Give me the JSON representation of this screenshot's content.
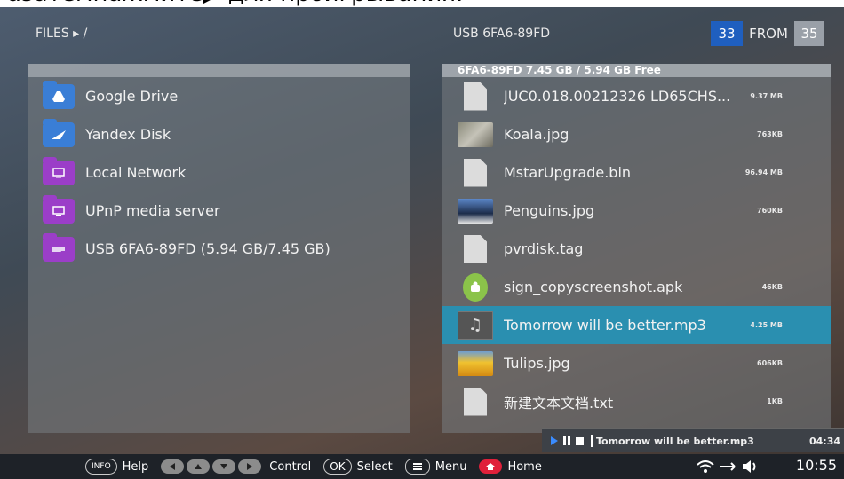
{
  "header": {
    "caption_fragment": "азатемнажмите▶ для проигрывания.",
    "path": "FILES ▸ /",
    "device": "USB 6FA6-89FD",
    "current": "33",
    "from_label": "FROM",
    "total": "35"
  },
  "left_panel": {
    "items": [
      {
        "label": "Google Drive",
        "icon": "google-drive-icon",
        "color": "#3a7ed6"
      },
      {
        "label": "Yandex Disk",
        "icon": "yandex-disk-icon",
        "color": "#3a7ed6"
      },
      {
        "label": "Local Network",
        "icon": "network-icon",
        "color": "#9b3ec8"
      },
      {
        "label": "UPnP media server",
        "icon": "upnp-icon",
        "color": "#9b3ec8"
      },
      {
        "label": "USB 6FA6-89FD (5.94 GB/7.45 GB)",
        "icon": "usb-icon",
        "color": "#9b3ec8"
      }
    ]
  },
  "right_panel": {
    "summary": "6FA6-89FD 7.45 GB / 5.94 GB Free",
    "files": [
      {
        "name": "JUC0.018.00212326  LD65CHS...",
        "size": "9.37 MB",
        "icon": "document-icon"
      },
      {
        "name": "Koala.jpg",
        "size": "763KB",
        "icon": "image-thumbnail"
      },
      {
        "name": "MstarUpgrade.bin",
        "size": "96.94 MB",
        "icon": "document-icon"
      },
      {
        "name": "Penguins.jpg",
        "size": "760KB",
        "icon": "image-thumbnail"
      },
      {
        "name": "pvrdisk.tag",
        "size": "",
        "icon": "document-icon"
      },
      {
        "name": "sign_copyscreenshot.apk",
        "size": "46KB",
        "icon": "android-icon"
      },
      {
        "name": "Tomorrow will be better.mp3",
        "size": "4.25 MB",
        "icon": "music-icon"
      },
      {
        "name": "Tulips.jpg",
        "size": "606KB",
        "icon": "image-thumbnail"
      },
      {
        "name": "新建文本文档.txt",
        "size": "1KB",
        "icon": "document-icon"
      }
    ],
    "selected_index": 6
  },
  "player": {
    "title": "Tomorrow will be better.mp3",
    "time": "04:34"
  },
  "footer": {
    "info_key": "INFO",
    "help": "Help",
    "control": "Control",
    "ok_key": "OK",
    "select": "Select",
    "menu": "Menu",
    "home": "Home",
    "clock": "10:55"
  },
  "colors": {
    "selection": "#2a8fb0",
    "counter_blue": "#1f5fbf",
    "home_red": "#e0203a"
  }
}
